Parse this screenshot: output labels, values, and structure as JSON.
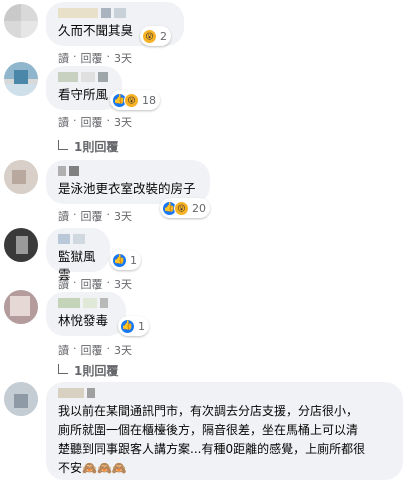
{
  "colors": {
    "bubble": "#f0f2f5",
    "meta": "#65676b",
    "like": "#1877f2",
    "wow": "#f7b125"
  },
  "comments": [
    {
      "text": "久而不聞其臭",
      "reactions": [
        "wow-icon"
      ],
      "reaction_count": "2",
      "actions": {
        "read": "讀",
        "sep": "·",
        "reply": "回覆",
        "time": "3天"
      }
    },
    {
      "text": "看守所風",
      "reactions": [
        "like-icon",
        "wow-icon"
      ],
      "reaction_count": "18",
      "actions": {
        "read": "讀",
        "sep": "·",
        "reply": "回覆",
        "time": "3天"
      },
      "replies_link": "1則回覆"
    },
    {
      "text": "是泳池更衣室改裝的房子",
      "reactions": [
        "like-icon",
        "wow-icon"
      ],
      "reaction_count": "20",
      "actions": {
        "read": "讀",
        "sep": "·",
        "reply": "回覆",
        "time": "3天"
      }
    },
    {
      "text": "監獄風雲",
      "reactions": [
        "like-icon"
      ],
      "reaction_count": "1",
      "actions": {
        "read": "讀",
        "sep": "·",
        "reply": "回覆",
        "time": "3天"
      }
    },
    {
      "text": "林悅發毒",
      "reactions": [
        "like-icon"
      ],
      "reaction_count": "1",
      "actions": {
        "read": "讀",
        "sep": "·",
        "reply": "回覆",
        "time": "3天"
      },
      "replies_link": "1則回覆"
    },
    {
      "text": "我以前在某間通訊門市，有次調去分店支援，分店很小，\n廁所就圍一個在櫃檯後方，隔音很差，坐在馬桶上可以清\n楚聽到同事跟客人講方案...有種0距離的感覺，上廁所都很\n不安🙈🙈🙈"
    }
  ]
}
